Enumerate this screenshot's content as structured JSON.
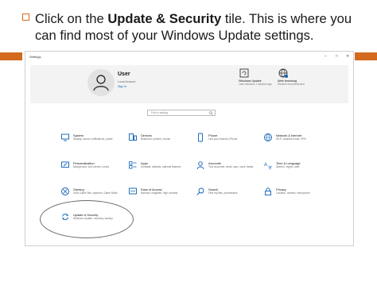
{
  "caption": {
    "pre": "Click on the ",
    "bold": "Update & Security",
    "post": " tile. This is where you can find most of your Windows Update settings."
  },
  "window": {
    "title": "Settings",
    "controls": {
      "minimize": "–",
      "maximize": "□",
      "close": "✕"
    }
  },
  "header": {
    "user_name": "User",
    "account_line": "Local Account",
    "sign_in": "Sign in",
    "windows_update": {
      "label": "Windows Update",
      "sub": "Last checked: 2 minutes ago"
    },
    "web_browsing": {
      "label": "Web browsing",
      "sub": "Restore recommended"
    }
  },
  "search": {
    "placeholder": "Find a setting"
  },
  "tiles": [
    {
      "label": "System",
      "desc": "Display, sound, notifications, power",
      "icon": "monitor-icon"
    },
    {
      "label": "Devices",
      "desc": "Bluetooth, printers, mouse",
      "icon": "keyboard-icon"
    },
    {
      "label": "Phone",
      "desc": "Link your Android, iPhone",
      "icon": "phone-icon"
    },
    {
      "label": "Network & Internet",
      "desc": "Wi-Fi, airplane mode, VPN",
      "icon": "globe-icon"
    },
    {
      "label": "Personalization",
      "desc": "Background, lock screen, colors",
      "icon": "paint-icon"
    },
    {
      "label": "Apps",
      "desc": "Uninstall, defaults, optional features",
      "icon": "apps-icon"
    },
    {
      "label": "Accounts",
      "desc": "Your accounts, email, sync, work, family",
      "icon": "person-icon"
    },
    {
      "label": "Time & Language",
      "desc": "Speech, region, date",
      "icon": "time-language-icon"
    },
    {
      "label": "Gaming",
      "desc": "Xbox Game Bar, captures, Game Mode",
      "icon": "xbox-icon"
    },
    {
      "label": "Ease of Access",
      "desc": "Narrator, magnifier, high contrast",
      "icon": "ease-of-access-icon"
    },
    {
      "label": "Search",
      "desc": "Find my files, permissions",
      "icon": "search-icon"
    },
    {
      "label": "Privacy",
      "desc": "Location, camera, microphone",
      "icon": "lock-icon"
    },
    {
      "label": "Update & Security",
      "desc": "Windows Update, recovery, backup",
      "icon": "sync-icon"
    }
  ],
  "colors": {
    "accent": "#d2691e",
    "icon_blue": "#0a5fb4"
  }
}
